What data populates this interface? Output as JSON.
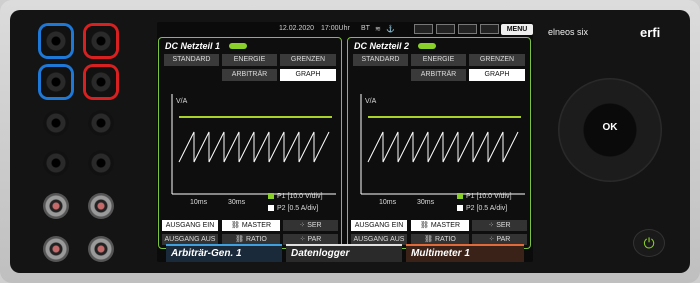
{
  "status": {
    "date": "12.02.2020",
    "time": "17:00Uhr",
    "bt": "BT",
    "menu": "MENU"
  },
  "panels": [
    {
      "title": "DC Netzteil 1",
      "buttons": [
        "STANDARD",
        "ENERGIE",
        "GRENZEN",
        "ARBITRÄR",
        "GRAPH"
      ],
      "ylabel": "V/A",
      "x_ticks": [
        "10ms",
        "30ms"
      ],
      "legend": [
        "P1 [10.0 V/div]",
        "P2 [0.5 A/div]"
      ],
      "actions": {
        "ein": "AUSGANG EIN",
        "aus": "AUSGANG AUS",
        "master": "MASTER",
        "ratio": "RATIO",
        "ser": "SER",
        "par": "PAR"
      }
    },
    {
      "title": "DC Netzteil 2",
      "buttons": [
        "STANDARD",
        "ENERGIE",
        "GRENZEN",
        "ARBITRÄR",
        "GRAPH"
      ],
      "ylabel": "V/A",
      "x_ticks": [
        "10ms",
        "30ms"
      ],
      "legend": [
        "P1 [10.0 V/div]",
        "P2 [0.5 A/div]"
      ],
      "actions": {
        "ein": "AUSGANG EIN",
        "aus": "AUSGANG AUS",
        "master": "MASTER",
        "ratio": "RATIO",
        "ser": "SER",
        "par": "PAR"
      }
    }
  ],
  "tabs": [
    {
      "label": "Arbiträr-Gen. 1",
      "color": "#3fa0e0"
    },
    {
      "label": "Datenlogger",
      "color": "#e0e0e0"
    },
    {
      "label": "Multimeter 1",
      "color": "#e06a3a"
    }
  ],
  "brand": {
    "model": "elneos six",
    "logo": "erfi"
  },
  "controls": {
    "ok": "OK",
    "power_icon": "power-icon"
  },
  "colors": {
    "accent": "#7cc242",
    "trace": "#ffffff",
    "limit": "#a8d22a"
  }
}
